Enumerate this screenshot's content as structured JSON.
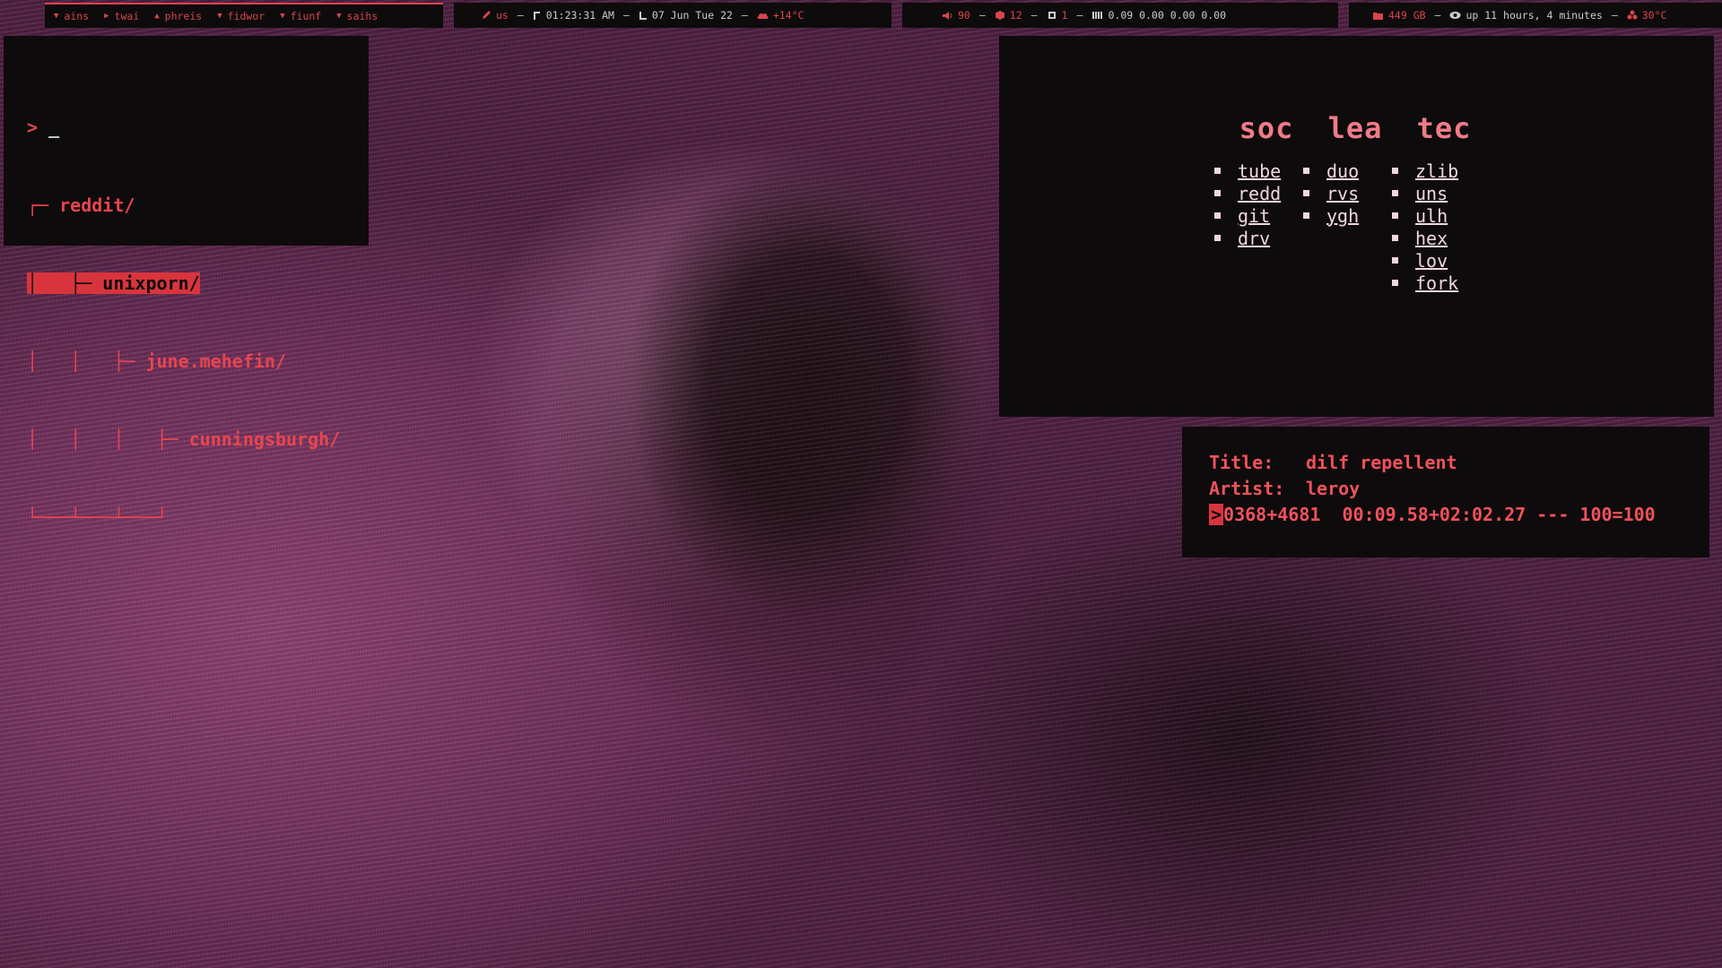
{
  "colors": {
    "accent": "#d9444c",
    "text_light": "#c9cccf",
    "panel": "#0e0b0c",
    "link": "#f2d7de",
    "header_pink": "#f07b88"
  },
  "topbar": {
    "workspaces": [
      {
        "label": "ains",
        "icon": "triangle-down-icon"
      },
      {
        "label": "twai",
        "icon": "triangle-right-icon"
      },
      {
        "label": "phreis",
        "icon": "triangle-up-icon"
      },
      {
        "label": "fidwor",
        "icon": "triangle-down-icon"
      },
      {
        "label": "fiunf",
        "icon": "triangle-down-icon"
      },
      {
        "label": "saihs",
        "icon": "triangle-down-icon"
      }
    ],
    "keyboard": "us",
    "time": "01:23:31 AM",
    "date": "07 Jun Tue 22",
    "weather": "+14°C",
    "volume": "90",
    "updates": "12",
    "cpu": "1",
    "load": "0.09 0.00 0.00 0.00",
    "disk": "449 GB",
    "uptime": "up 11 hours, 4 minutes",
    "temp": "30°C"
  },
  "terminal": {
    "prompt": ">",
    "cursor": "_",
    "tree": [
      "┌─ reddit/",
      "├─ unixporn/",
      "├─ june.mehefin/",
      "├─ cunningsburgh/"
    ]
  },
  "startpage": {
    "columns": [
      {
        "title": "soc",
        "links": [
          "tube",
          "redd",
          "git",
          "drv"
        ]
      },
      {
        "title": "lea",
        "links": [
          "duo",
          "rvs",
          "ygh"
        ]
      },
      {
        "title": "tec",
        "links": [
          "zlib",
          "uns",
          "ulh",
          "hex",
          "lov",
          "fork"
        ]
      }
    ]
  },
  "music": {
    "title_label": "Title:",
    "title": "dilf repellent",
    "artist_label": "Artist:",
    "artist": "leroy",
    "prompt": ">",
    "status": "0368+4681  00:09.58+02:02.27 --- 100=100"
  }
}
